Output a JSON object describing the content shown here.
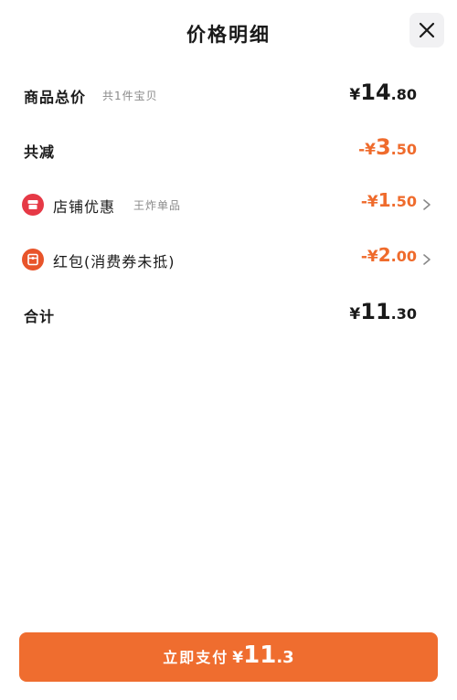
{
  "header": {
    "title": "价格明细",
    "close_icon": "close-icon"
  },
  "rows": {
    "goods_total": {
      "label": "商品总价",
      "sublabel": "共1件宝贝",
      "currency": "¥",
      "int": "14",
      "dec": ".80"
    },
    "total_discount": {
      "label": "共减",
      "currency": "-¥",
      "int": "3",
      "dec": ".50",
      "color": "#ef6b2c"
    },
    "shop_discount": {
      "icon": "shop-icon",
      "icon_color": "#e63946",
      "label": "店铺优惠",
      "sublabel": "王炸单品",
      "currency": "-¥",
      "int": "1",
      "dec": ".50",
      "color": "#ef6b2c"
    },
    "red_packet": {
      "icon": "red-packet-icon",
      "icon_color": "#e8542a",
      "label": "红包(消费券未抵)",
      "currency": "-¥",
      "int": "2",
      "dec": ".00",
      "color": "#ef6b2c"
    },
    "sum": {
      "label": "合计",
      "currency": "¥",
      "int": "11",
      "dec": ".30"
    }
  },
  "pay_button": {
    "label": "立即支付",
    "currency": "¥",
    "int": "11",
    "dec": ".3",
    "color": "#ef6d2f"
  }
}
